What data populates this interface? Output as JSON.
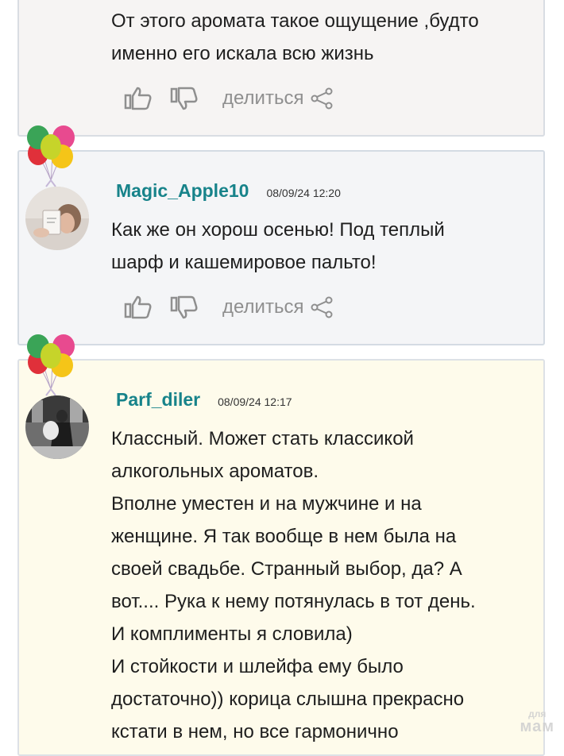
{
  "comments": [
    {
      "text_lines": [
        "От этого аромата такое ощущение ,будто",
        "именно его искала всю жизнь"
      ],
      "share_label": "делиться"
    },
    {
      "username": "Magic_Apple10",
      "date": "08/09/24 12:20",
      "text_lines": [
        "Как же он хорош осенью! Под теплый",
        "шарф и кашемировое пальто!"
      ],
      "share_label": "делиться"
    },
    {
      "username": "Parf_diler",
      "date": "08/09/24 12:17",
      "text_lines": [
        "Классный. Может стать классикой",
        "алкогольных ароматов.",
        "Вполне уместен и на мужчине и на",
        "женщине. Я так вообще в нем была на",
        "своей свадьбе. Странный выбор, да? А",
        "вот.... Рука к нему потянулась в тот день.",
        "И комплименты я словила)",
        "И стойкости и шлейфа ему было",
        "достаточно)) корица слышна прекрасно",
        "кстати в нем, но все гармонично"
      ]
    }
  ],
  "watermark": {
    "line1": "для",
    "line2": "мам"
  },
  "colors": {
    "username": "#17838a",
    "card_default": "#f4f5f7",
    "card_highlight": "#fefbeb",
    "icon_gray": "#8f8f8f"
  },
  "icons": [
    "thumbs-up-icon",
    "thumbs-down-icon",
    "share-icon",
    "balloons-icon"
  ]
}
